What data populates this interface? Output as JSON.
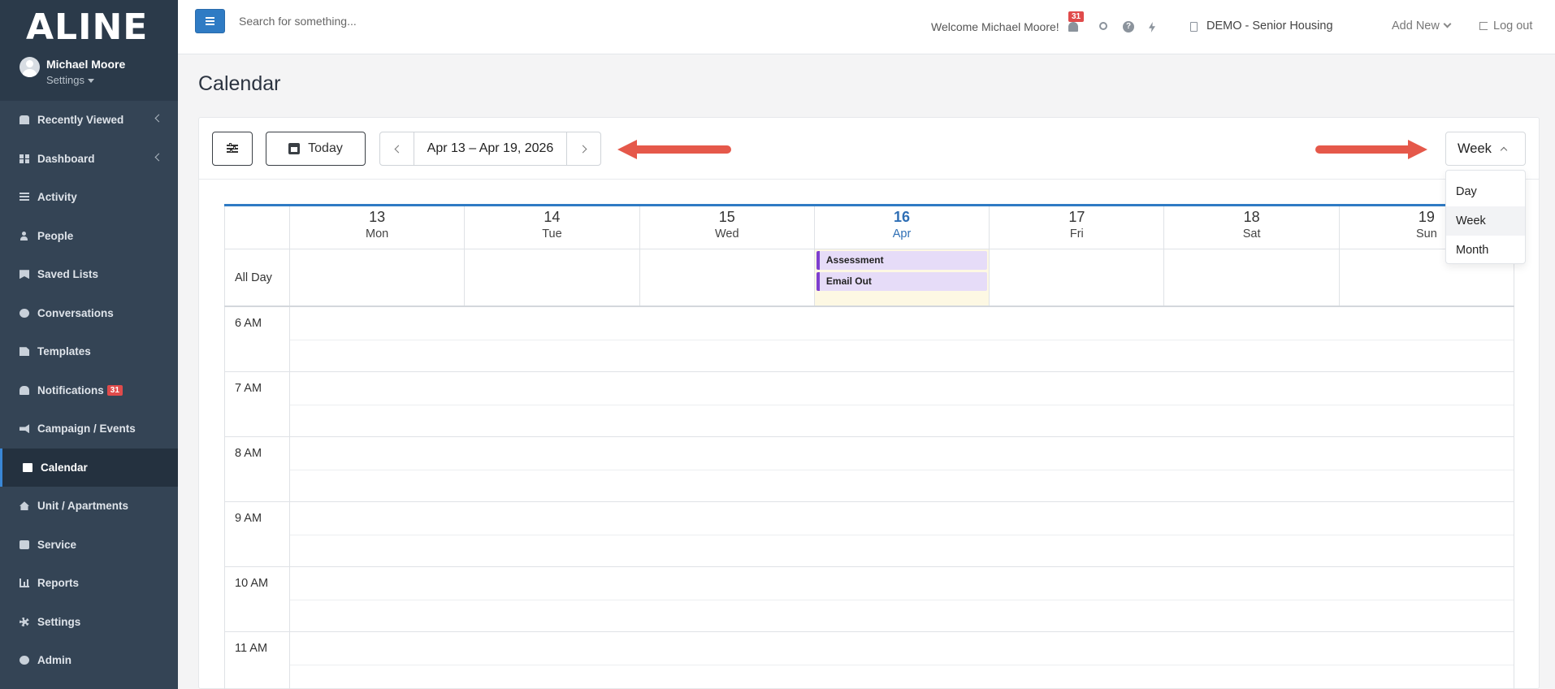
{
  "sidebar": {
    "logo": "ALINE",
    "user_name": "Michael Moore",
    "user_settings": "Settings",
    "items": [
      {
        "label": "Recently Viewed",
        "icon": "users-icon"
      },
      {
        "label": "Dashboard",
        "icon": "dashboard-icon"
      },
      {
        "label": "Activity",
        "icon": "activity-icon"
      },
      {
        "label": "People",
        "icon": "person-icon"
      },
      {
        "label": "Saved Lists",
        "icon": "bookmark-icon"
      },
      {
        "label": "Conversations",
        "icon": "chat-icon"
      },
      {
        "label": "Templates",
        "icon": "file-icon"
      },
      {
        "label": "Notifications",
        "icon": "bell-icon",
        "badge": "31"
      },
      {
        "label": "Campaign / Events",
        "icon": "megaphone-icon"
      },
      {
        "label": "Calendar",
        "icon": "calendar-icon",
        "active": true
      },
      {
        "label": "Unit / Apartments",
        "icon": "home-icon"
      },
      {
        "label": "Service",
        "icon": "briefcase-icon"
      },
      {
        "label": "Reports",
        "icon": "bar-chart-icon"
      },
      {
        "label": "Settings",
        "icon": "gear-icon"
      },
      {
        "label": "Admin",
        "icon": "gears-icon"
      }
    ]
  },
  "topbar": {
    "search_placeholder": "Search for something...",
    "welcome": "Welcome Michael Moore!",
    "notification_count": "31",
    "help_glyph": "?",
    "org_name": "DEMO - Senior Housing",
    "add_new": "Add New",
    "logout": "Log out"
  },
  "page": {
    "title": "Calendar"
  },
  "calendar": {
    "today_label": "Today",
    "range_label": "Apr 13 – Apr 19, 2026",
    "view_selected": "Week",
    "view_options": [
      "Day",
      "Week",
      "Month"
    ],
    "all_day_label": "All Day",
    "days": [
      {
        "num": "13",
        "name": "Mon"
      },
      {
        "num": "14",
        "name": "Tue"
      },
      {
        "num": "15",
        "name": "Wed"
      },
      {
        "num": "16",
        "name": "Apr",
        "today": true
      },
      {
        "num": "17",
        "name": "Fri"
      },
      {
        "num": "18",
        "name": "Sat"
      },
      {
        "num": "19",
        "name": "Sun"
      }
    ],
    "all_day_events": [
      "Assessment",
      "Email Out"
    ],
    "time_labels": [
      "6 AM",
      "7 AM",
      "8 AM",
      "9 AM",
      "10 AM",
      "11 AM"
    ]
  },
  "colors": {
    "sidebar_bg": "#344455",
    "primary": "#2f7bc4",
    "event_accent": "#7e3fcf",
    "annotation_arrow": "#e5584a",
    "badge": "#e04b4b"
  }
}
